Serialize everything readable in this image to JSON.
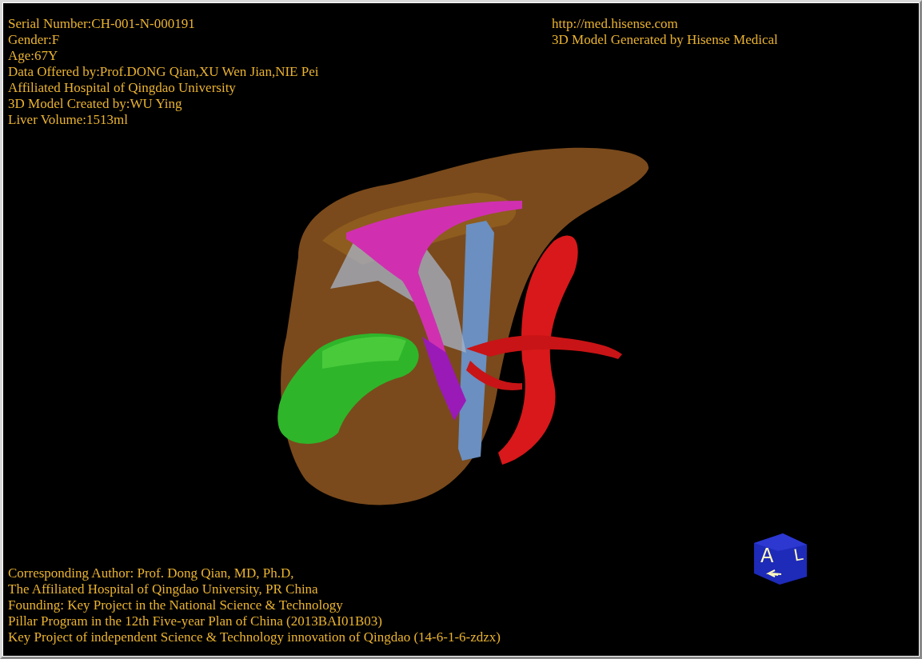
{
  "info_top_left": [
    "Serial Number:CH-001-N-000191",
    "Gender:F",
    "Age:67Y",
    "Data Offered by:Prof.DONG Qian,XU Wen Jian,NIE Pei",
    "Affiliated Hospital of Qingdao University",
    "3D Model Created by:WU Ying",
    "Liver Volume:1513ml"
  ],
  "info_top_right": [
    "http://med.hisense.com",
    "3D Model Generated by Hisense Medical"
  ],
  "info_bottom_left": [
    "Corresponding Author: Prof. Dong Qian, MD, Ph.D,",
    "The Affiliated Hospital of Qingdao University, PR China",
    "Founding: Key Project in the National Science & Technology",
    "Pillar Program in the 12th Five-year Plan of China (2013BAI01B03)",
    "Key Project of independent Science & Technology innovation of Qingdao (14-6-1-6-zdzx)"
  ],
  "orientation_cube": {
    "front_label": "A",
    "side_label": "L"
  }
}
